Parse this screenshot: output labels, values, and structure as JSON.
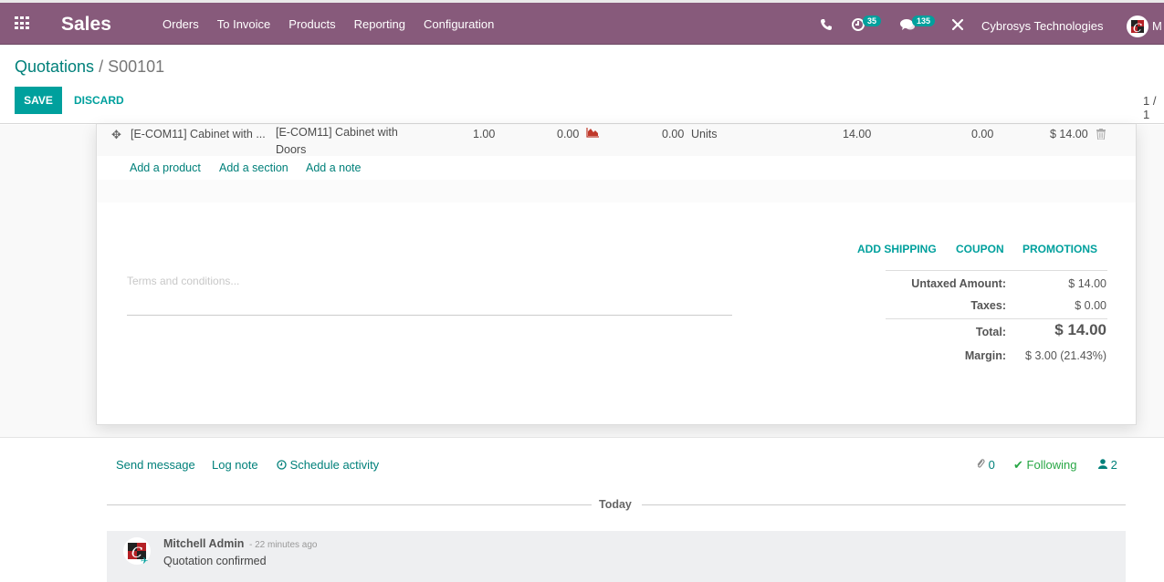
{
  "navbar": {
    "app_name": "Sales",
    "menu": [
      "Orders",
      "To Invoice",
      "Products",
      "Reporting",
      "Configuration"
    ],
    "activity_count": "35",
    "message_count": "135",
    "company": "Cybrosys Technologies",
    "user_initial": "M",
    "brand_color": "#875a7b",
    "accent_color": "#00a09d"
  },
  "control_panel": {
    "breadcrumb_parent": "Quotations",
    "breadcrumb_separator": "/",
    "breadcrumb_current": "S00101",
    "save_label": "SAVE",
    "discard_label": "DISCARD",
    "pager": "1 / 1"
  },
  "order_lines": [
    {
      "product": "[E-COM11] Cabinet with ...",
      "description": "[E-COM11] Cabinet with Doors",
      "quantity": "1.00",
      "delivered": "0.00",
      "invoiced": "0.00",
      "uom": "Units",
      "unit_price": "14.00",
      "discount": "0.00",
      "subtotal": "$ 14.00"
    }
  ],
  "line_actions": {
    "add_product": "Add a product",
    "add_section": "Add a section",
    "add_note": "Add a note"
  },
  "sheet_buttons": {
    "add_shipping": "ADD SHIPPING",
    "coupon": "COUPON",
    "promotions": "PROMOTIONS"
  },
  "terms": {
    "placeholder": "Terms and conditions..."
  },
  "totals": {
    "untaxed_label": "Untaxed Amount:",
    "untaxed_value": "$ 14.00",
    "taxes_label": "Taxes:",
    "taxes_value": "$ 0.00",
    "total_label": "Total:",
    "total_value": "$ 14.00",
    "margin_label": "Margin:",
    "margin_value": "$ 3.00 (21.43%)"
  },
  "chatter": {
    "send_message": "Send message",
    "log_note": "Log note",
    "schedule_activity": "Schedule activity",
    "attachments_count": "0",
    "following_label": "Following",
    "followers_count": "2",
    "date_separator": "Today",
    "messages": [
      {
        "author": "Mitchell Admin",
        "time": "- 22 minutes ago",
        "body": "Quotation confirmed"
      }
    ]
  }
}
